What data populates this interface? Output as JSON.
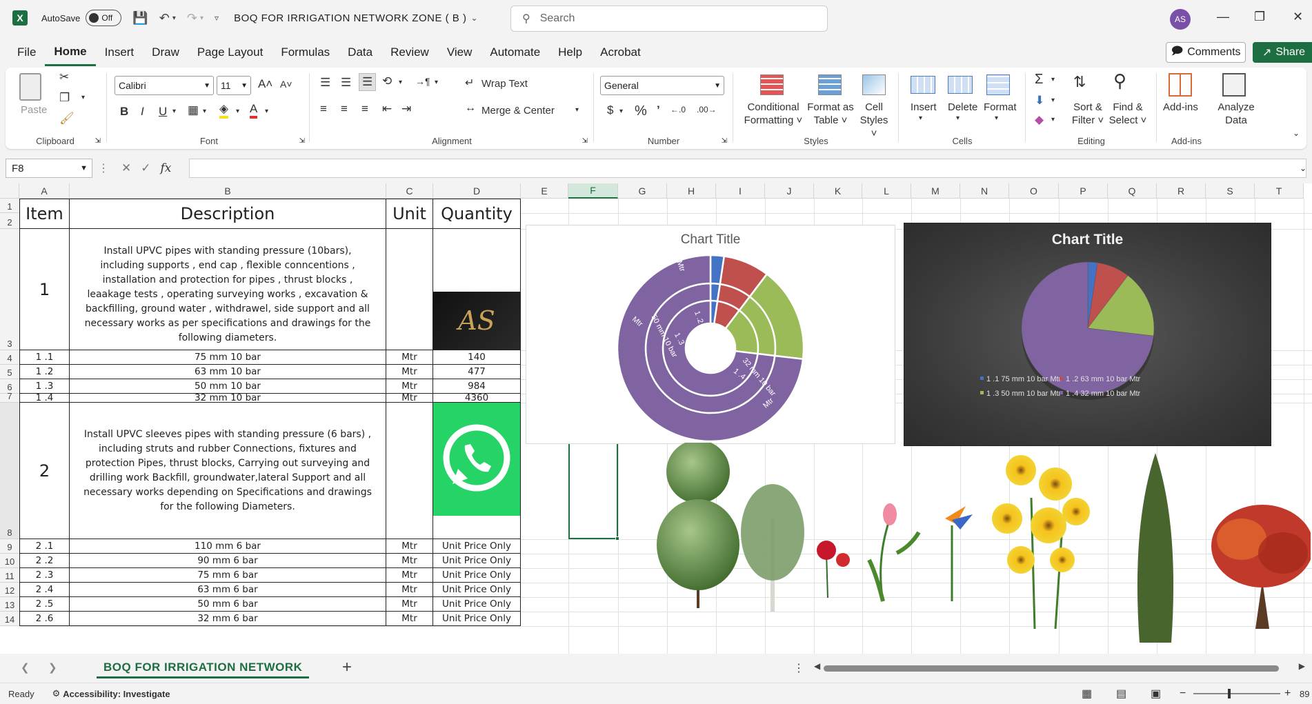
{
  "titlebar": {
    "app_icon": "X",
    "autosave_label": "AutoSave",
    "autosave_state": "Off",
    "doc_title": "BOQ  FOR  IRRIGATION  NETWORK  ZONE ( B )",
    "search_placeholder": "Search",
    "user_initials": "AS"
  },
  "menu": [
    "File",
    "Home",
    "Insert",
    "Draw",
    "Page Layout",
    "Formulas",
    "Data",
    "Review",
    "View",
    "Automate",
    "Help",
    "Acrobat"
  ],
  "menu_active": "Home",
  "actions": {
    "comments": "Comments",
    "share": "Share"
  },
  "ribbon": {
    "clipboard": {
      "paste": "Paste",
      "label": "Clipboard"
    },
    "font": {
      "name": "Calibri",
      "size": "11",
      "label": "Font"
    },
    "alignment": {
      "wrap": "Wrap Text",
      "merge": "Merge & Center",
      "label": "Alignment"
    },
    "number": {
      "format": "General",
      "label": "Number"
    },
    "styles": {
      "conditional": [
        "Conditional",
        "Formatting"
      ],
      "format_table": [
        "Format as",
        "Table"
      ],
      "cell_styles": [
        "Cell",
        "Styles"
      ],
      "label": "Styles"
    },
    "cells": {
      "insert": "Insert",
      "delete": "Delete",
      "format": "Format",
      "label": "Cells"
    },
    "editing": {
      "sort": [
        "Sort &",
        "Filter"
      ],
      "find": [
        "Find &",
        "Select"
      ],
      "label": "Editing"
    },
    "addins": {
      "addins": "Add-ins",
      "analyze": [
        "Analyze",
        "Data"
      ],
      "label": "Add-ins"
    }
  },
  "formula_bar": {
    "cell_ref": "F8",
    "fx": "fx",
    "value": ""
  },
  "columns": [
    "A",
    "B",
    "C",
    "D",
    "E",
    "F",
    "G",
    "H",
    "I",
    "J",
    "K",
    "L",
    "M",
    "N",
    "O",
    "P",
    "Q",
    "R",
    "S",
    "T"
  ],
  "selected_column": "F",
  "rows": [
    "1",
    "2",
    "3",
    "4",
    "5",
    "6",
    "7",
    "8",
    "9",
    "10",
    "11",
    "12",
    "13",
    "14"
  ],
  "table": {
    "headers": {
      "item": "Item",
      "description": "Description",
      "unit": "Unit",
      "quantity": "Quantity"
    },
    "section1": {
      "item": "1",
      "description": "Install UPVC pipes with standing pressure (10bars), including supports , end cap , flexible conncentions , installation and protection for pipes , thrust blocks , leaakage tests , operating surveying works , excavation & backfilling, ground water , withdrawel, side support and all necessary works as per specifications and drawings for the following diameters."
    },
    "rows1": [
      {
        "item": "1 .1",
        "desc": "75 mm 10 bar",
        "unit": "Mtr",
        "qty": "140"
      },
      {
        "item": "1 .2",
        "desc": "63 mm 10 bar",
        "unit": "Mtr",
        "qty": "477"
      },
      {
        "item": "1 .3",
        "desc": "50 mm 10 bar",
        "unit": "Mtr",
        "qty": "984"
      },
      {
        "item": "1 .4",
        "desc": "32 mm 10 bar",
        "unit": "Mtr",
        "qty": "4360"
      }
    ],
    "section2": {
      "item": "2",
      "description": "Install UPVC sleeves pipes with standing pressure (6 bars) , including struts and rubber Connections, fixtures and protection Pipes, thrust blocks, Carrying out surveying and drilling work Backfill, groundwater,lateral Support and all necessary works depending on Specifications and drawings for the following Diameters."
    },
    "rows2": [
      {
        "item": "2 .1",
        "desc": "110 mm 6 bar",
        "unit": "Mtr",
        "qty": "Unit Price Only"
      },
      {
        "item": "2 .2",
        "desc": "90 mm 6 bar",
        "unit": "Mtr",
        "qty": "Unit Price Only"
      },
      {
        "item": "2 .3",
        "desc": "75 mm 6 bar",
        "unit": "Mtr",
        "qty": "Unit Price Only"
      },
      {
        "item": "2 .4",
        "desc": "63 mm 6 bar",
        "unit": "Mtr",
        "qty": "Unit Price Only"
      },
      {
        "item": "2 .5",
        "desc": "50 mm 6 bar",
        "unit": "Mtr",
        "qty": "Unit Price Only"
      },
      {
        "item": "2 .6",
        "desc": "32 mm 6 bar",
        "unit": "Mtr",
        "qty": "Unit Price Only"
      }
    ]
  },
  "logo_text": "AS",
  "chart_data": [
    {
      "type": "sunburst",
      "title": "Chart Title",
      "categories": [
        "1 .1 75 mm 10 bar Mtr",
        "1 .2 63 mm 10 bar Mtr",
        "1 .3 50 mm 10 bar Mtr",
        "1 .4 32 mm 10 bar Mtr"
      ],
      "values": [
        140,
        477,
        984,
        4360
      ],
      "colors": [
        "#4472c4",
        "#c0504d",
        "#9bbb59",
        "#8064a2"
      ],
      "ring_labels": {
        "inner": [
          "1 .2",
          "1 .3",
          "1 .4"
        ],
        "middle": [
          "50 mm 10 bar",
          "32 mm 10 bar"
        ],
        "outer": [
          "Mtr",
          "Mtr",
          "Mtr"
        ]
      }
    },
    {
      "type": "pie",
      "title": "Chart Title",
      "categories": [
        "1 .1 75 mm 10 bar Mtr",
        "1 .2 63 mm 10 bar Mtr",
        "1 .3 50 mm 10 bar Mtr",
        "1 .4 32 mm 10 bar Mtr"
      ],
      "values": [
        140,
        477,
        984,
        4360
      ],
      "colors": [
        "#4472c4",
        "#c0504d",
        "#9bbb59",
        "#8064a2"
      ],
      "legend": "bottom"
    }
  ],
  "sheet_tabs": [
    "BOQ  FOR  IRRIGATION  NETWORK"
  ],
  "status": {
    "ready": "Ready",
    "accessibility": "Accessibility: Investigate",
    "zoom": "89"
  }
}
